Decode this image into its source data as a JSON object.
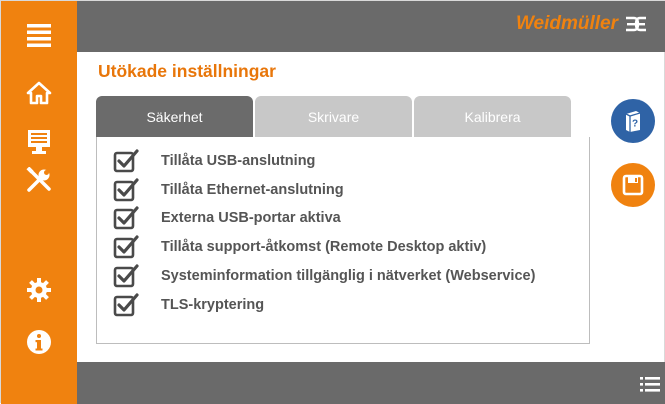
{
  "header": {
    "brand": "Weidmüller"
  },
  "sidebar": {
    "items": [
      {
        "icon": "menu-icon"
      },
      {
        "icon": "home-icon"
      },
      {
        "icon": "monitor-icon"
      },
      {
        "icon": "tools-icon"
      },
      {
        "icon": "gear-icon"
      },
      {
        "icon": "info-icon"
      }
    ]
  },
  "page": {
    "title": "Utökade inställningar"
  },
  "tabs": [
    {
      "label": "Säkerhet",
      "active": true
    },
    {
      "label": "Skrivare",
      "active": false
    },
    {
      "label": "Kalibrera",
      "active": false
    }
  ],
  "settings": [
    {
      "label": "Tillåta USB-anslutning",
      "checked": true
    },
    {
      "label": "Tillåta Ethernet-anslutning",
      "checked": true
    },
    {
      "label": "Externa USB-portar aktiva",
      "checked": true
    },
    {
      "label": "Tillåta support-åtkomst (Remote Desktop aktiv)",
      "checked": true
    },
    {
      "label": "Systeminformation tillgänglig i nätverket (Webservice)",
      "checked": true
    },
    {
      "label": "TLS-kryptering",
      "checked": true
    }
  ],
  "actions": [
    {
      "icon": "help-book-icon",
      "color": "#2f63a6"
    },
    {
      "icon": "save-icon",
      "color": "#f0820f"
    }
  ],
  "colors": {
    "accent": "#f0820f",
    "bar": "#6a6a6a",
    "help": "#2f63a6"
  }
}
